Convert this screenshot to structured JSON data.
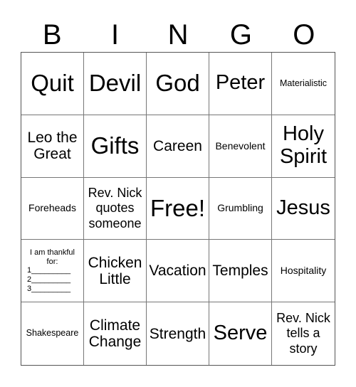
{
  "header": {
    "letters": [
      "B",
      "I",
      "N",
      "G",
      "O"
    ]
  },
  "cells": [
    "Quit",
    "Devil",
    "God",
    "Peter",
    "Materialistic",
    "Leo the Great",
    "Gifts",
    "Careen",
    "Benevolent",
    "Holy Spirit",
    "Foreheads",
    "Rev. Nick quotes someone",
    "Free!",
    "Grumbling",
    "Jesus",
    "I am thankful for:",
    "Chicken Little",
    "Vacation",
    "Temples",
    "Hospitality",
    "Shakespeare",
    "Climate Change",
    "Strength",
    "Serve",
    "Rev. Nick tells a story"
  ],
  "thankful_lines": [
    "1_________",
    "2_________",
    "3_________"
  ]
}
